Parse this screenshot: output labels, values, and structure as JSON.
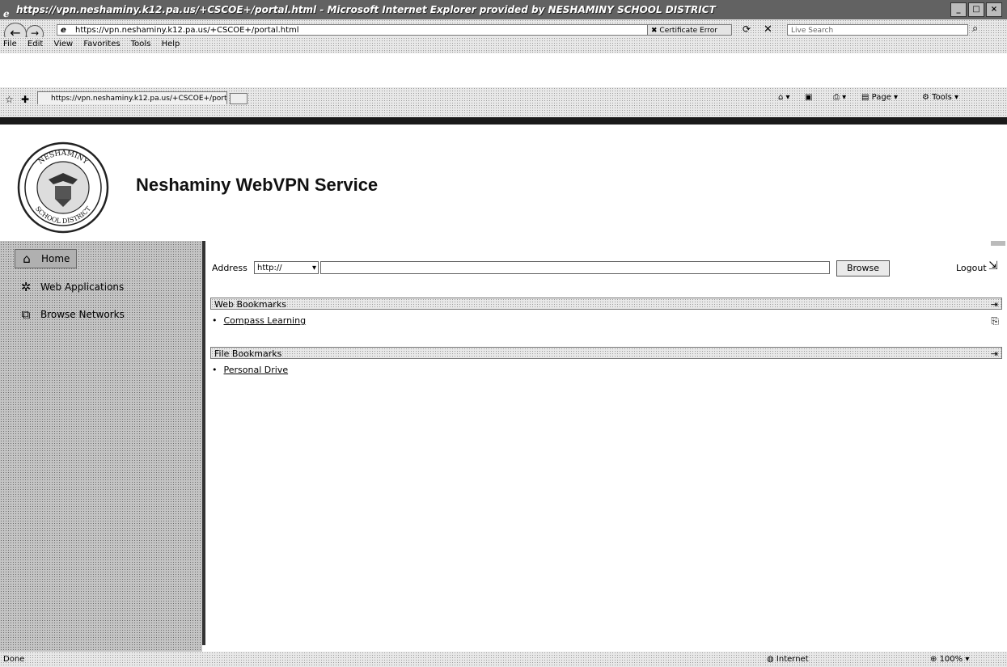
{
  "window": {
    "title": "https://vpn.neshaminy.k12.pa.us/+CSCOE+/portal.html - Microsoft Internet Explorer provided by NESHAMINY SCHOOL DISTRICT",
    "min": "_",
    "max": "□",
    "close": "×"
  },
  "toolbar": {
    "address": "https://vpn.neshaminy.k12.pa.us/+CSCOE+/portal.html",
    "cert": "Certificate Error",
    "search_placeholder": "Live Search"
  },
  "menu": {
    "items": [
      "File",
      "Edit",
      "View",
      "Favorites",
      "Tools",
      "Help"
    ]
  },
  "tabs": {
    "active_label": "https://vpn.neshaminy.k12.pa.us/+CSCOE+/portal.h..."
  },
  "commands": {
    "page": "Page",
    "tools": "Tools"
  },
  "banner": {
    "title": "Neshaminy WebVPN Service",
    "seal_top": "NESHAMINY",
    "seal_bottom": "SCHOOL DISTRICT"
  },
  "sidebar": {
    "items": [
      {
        "label": "Home",
        "icon": "home-icon"
      },
      {
        "label": "Web Applications",
        "icon": "web-applications-icon"
      },
      {
        "label": "Browse Networks",
        "icon": "browse-networks-icon"
      }
    ]
  },
  "portal": {
    "address_label": "Address",
    "protocol": "http://",
    "browse": "Browse",
    "logout": "Logout",
    "sections": [
      {
        "title": "Web Bookmarks",
        "items": [
          "Compass Learning"
        ]
      },
      {
        "title": "File Bookmarks",
        "items": [
          "Personal Drive"
        ]
      }
    ]
  },
  "status": {
    "text": "Done",
    "zone": "Internet",
    "zoom": "100%"
  }
}
